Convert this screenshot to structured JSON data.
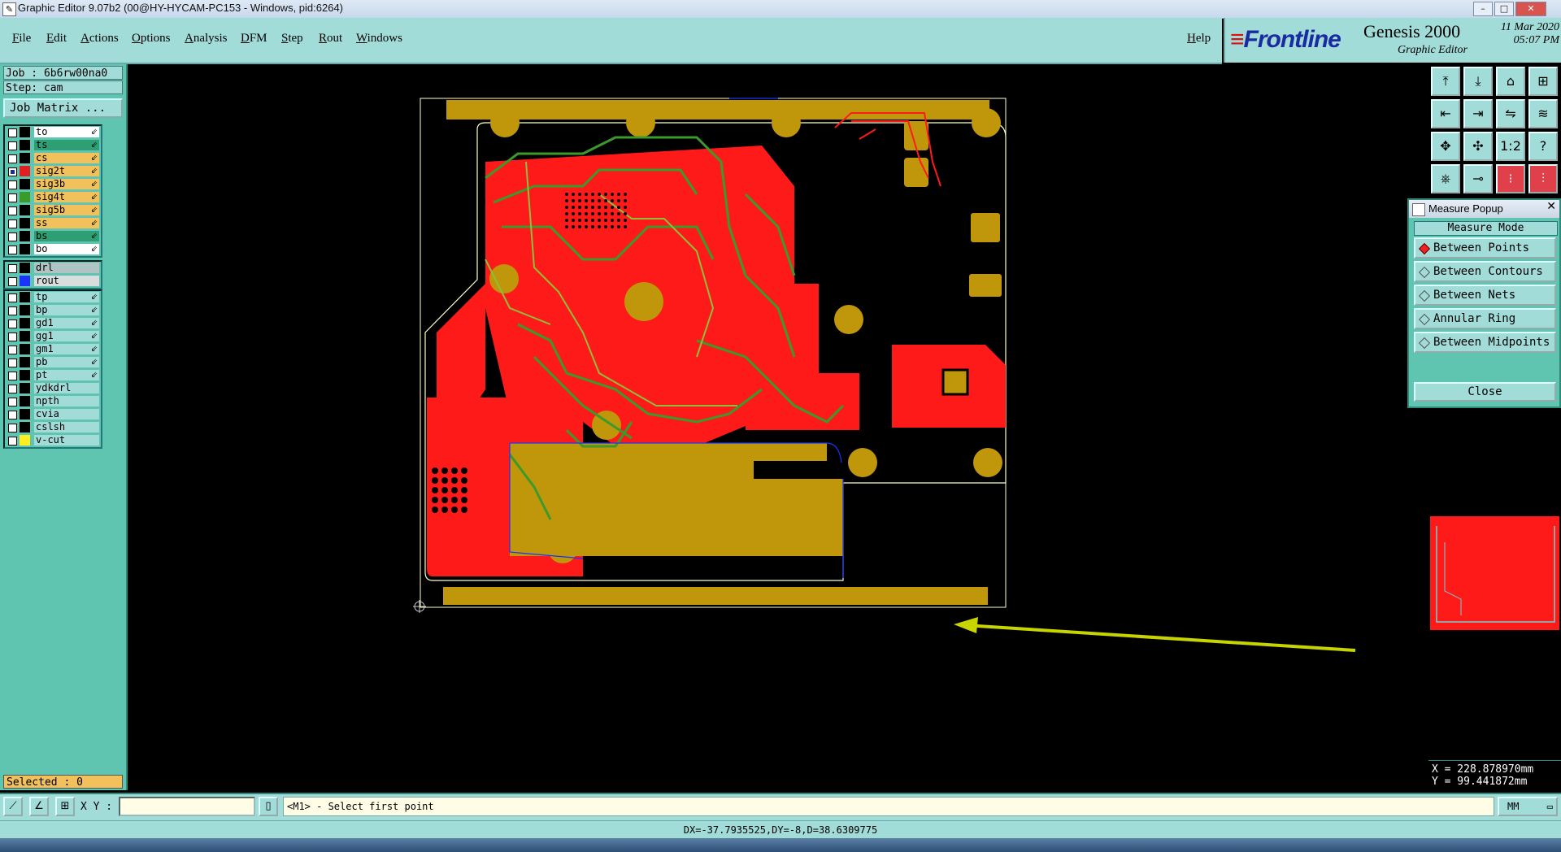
{
  "window": {
    "title": "Graphic Editor 9.07b2 (00@HY-HYCAM-PC153 - Windows, pid:6264)",
    "controls": [
      "–",
      "□",
      "✕"
    ]
  },
  "menu": [
    "File",
    "Edit",
    "Actions",
    "Options",
    "Analysis",
    "DFM",
    "Step",
    "Rout",
    "Windows"
  ],
  "help_label": "Help",
  "brand": {
    "logo": "Frontline",
    "product": "Genesis 2000",
    "subtitle": "Graphic Editor",
    "date": "11 Mar 2020",
    "time": "05:07 PM"
  },
  "job": "Job : 6b6rw00na0",
  "step": "Step: cam",
  "job_matrix_label": "Job Matrix ...",
  "layers_group1": [
    {
      "name": "to",
      "color": "#ffffff",
      "swatch": "#000000",
      "checked": false
    },
    {
      "name": "ts",
      "color": "#2e9e74",
      "swatch": "#000000",
      "checked": false
    },
    {
      "name": "cs",
      "color": "#f2c15c",
      "swatch": "#000000",
      "checked": false
    },
    {
      "name": "sig2t",
      "color": "#f2c15c",
      "swatch": "#e02020",
      "checked": true
    },
    {
      "name": "sig3b",
      "color": "#f2c15c",
      "swatch": "#000000",
      "checked": false
    },
    {
      "name": "sig4t",
      "color": "#f2c15c",
      "swatch": "#3a9a2a",
      "checked": false
    },
    {
      "name": "sig5b",
      "color": "#f2c15c",
      "swatch": "#000000",
      "checked": false
    },
    {
      "name": "ss",
      "color": "#f2c15c",
      "swatch": "#000000",
      "checked": false
    },
    {
      "name": "bs",
      "color": "#2e9e74",
      "swatch": "#000000",
      "checked": false
    },
    {
      "name": "bo",
      "color": "#ffffff",
      "swatch": "#000000",
      "checked": false
    }
  ],
  "layers_group2": [
    {
      "name": "drl",
      "color": "#b0c4c4",
      "swatch": "#000000",
      "checked": false
    },
    {
      "name": "rout",
      "color": "#d8dede",
      "swatch": "#1a33ff",
      "checked": false
    }
  ],
  "layers_group3": [
    {
      "name": "tp",
      "color": "#a2dcd8",
      "swatch": "#000000",
      "checked": false
    },
    {
      "name": "bp",
      "color": "#a2dcd8",
      "swatch": "#000000",
      "checked": false
    },
    {
      "name": "gd1",
      "color": "#a2dcd8",
      "swatch": "#000000",
      "checked": false
    },
    {
      "name": "gg1",
      "color": "#a2dcd8",
      "swatch": "#000000",
      "checked": false
    },
    {
      "name": "gm1",
      "color": "#a2dcd8",
      "swatch": "#000000",
      "checked": false
    },
    {
      "name": "pb",
      "color": "#a2dcd8",
      "swatch": "#000000",
      "checked": false
    },
    {
      "name": "pt",
      "color": "#a2dcd8",
      "swatch": "#000000",
      "checked": false
    },
    {
      "name": "ydkdrl",
      "color": "#a2dcd8",
      "swatch": "#000000",
      "checked": false
    },
    {
      "name": "npth",
      "color": "#a2dcd8",
      "swatch": "#000000",
      "checked": false
    },
    {
      "name": "cvia",
      "color": "#a2dcd8",
      "swatch": "#000000",
      "checked": false
    },
    {
      "name": "cslsh",
      "color": "#a2dcd8",
      "swatch": "#000000",
      "checked": false
    },
    {
      "name": "v-cut",
      "color": "#a2dcd8",
      "swatch": "#ffee22",
      "checked": false
    }
  ],
  "selected": "Selected : 0",
  "measure_popup": {
    "title": "Measure Popup",
    "mode_label": "Measure Mode",
    "options": [
      {
        "label": "Between Points",
        "on": true
      },
      {
        "label": "Between Contours",
        "on": false
      },
      {
        "label": "Between Nets",
        "on": false
      },
      {
        "label": "Annular Ring",
        "on": false
      },
      {
        "label": "Between Midpoints",
        "on": false
      }
    ],
    "close_label": "Close"
  },
  "coords": {
    "x": "X = 228.878970mm",
    "y": "Y = 99.441872mm"
  },
  "xy_label": "X Y :",
  "xy_value": "",
  "prompt": "<M1> - Select first point",
  "units": "MM",
  "status": "DX=-37.7935525,DY=-8,D=38.6309775",
  "colors": {
    "panel": "#5fc5b0",
    "button": "#a2dcd8",
    "copper_red": "#ff1a1a",
    "gold": "#c0960a",
    "trace_green": "#3a9a2a"
  }
}
